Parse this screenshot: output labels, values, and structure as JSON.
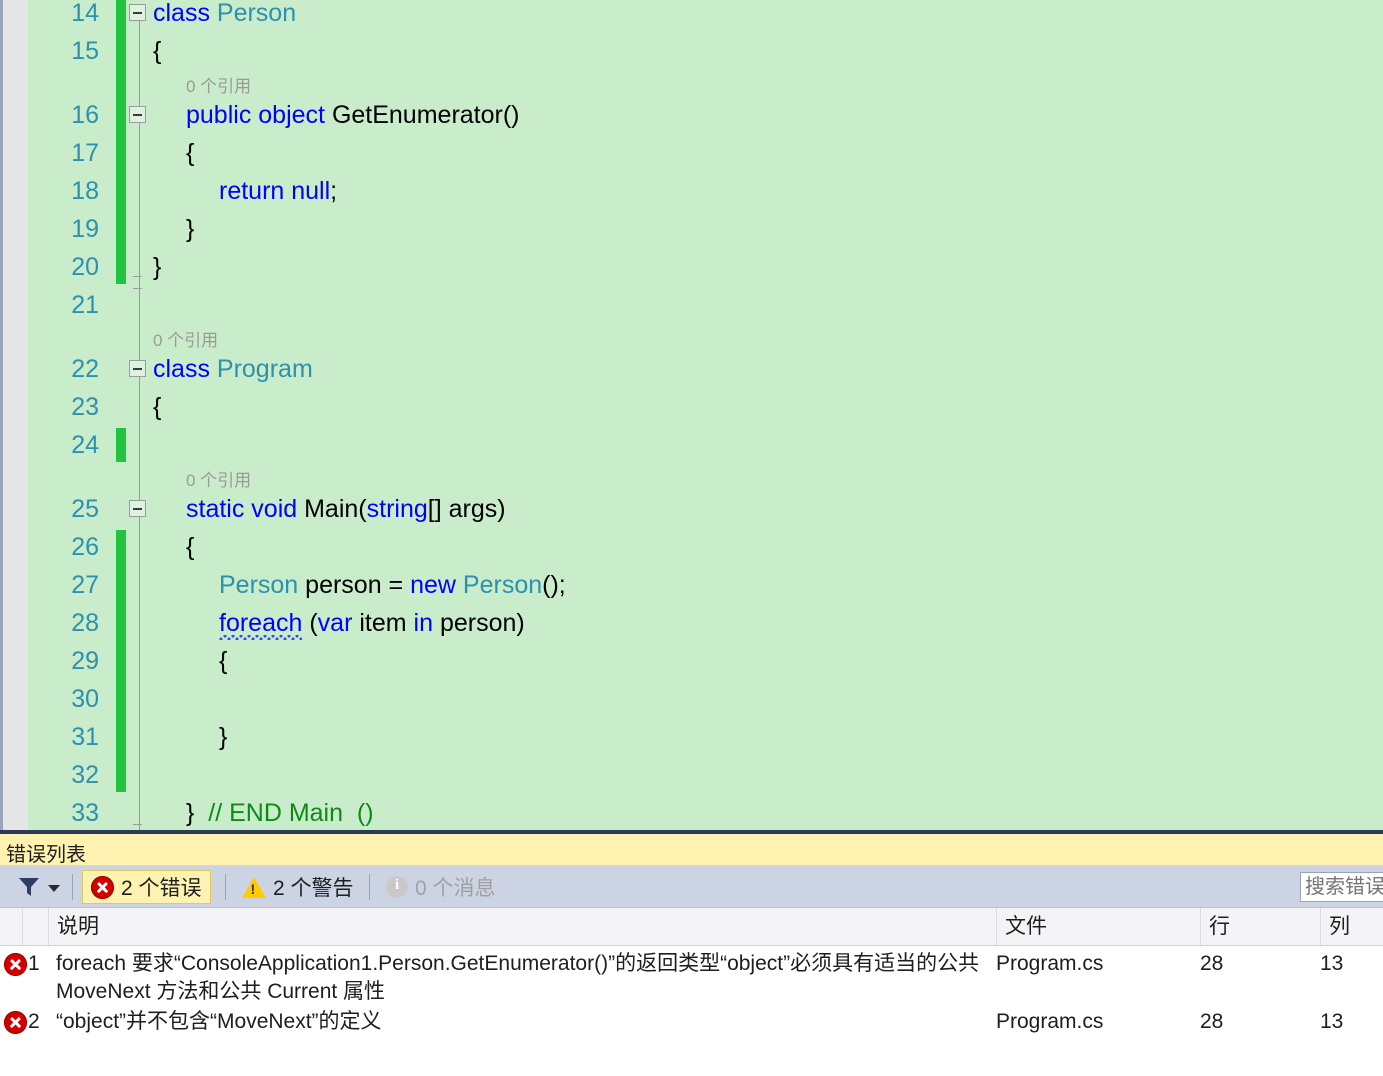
{
  "editor": {
    "background_color": "#c9ecca",
    "line_number_color": "#2b91af",
    "change_bar_color": "#22c33f",
    "reference_lens_text": "0 个引用",
    "lines": [
      {
        "num": "14",
        "indent": 0,
        "segments": [
          {
            "t": "class ",
            "c": "kw"
          },
          {
            "t": "Person",
            "c": "type"
          }
        ]
      },
      {
        "num": "15",
        "indent": 0,
        "segments": [
          {
            "t": "{",
            "c": "plain"
          }
        ]
      },
      {
        "num": "16",
        "indent": 1,
        "segments": [
          {
            "t": "public object ",
            "c": "kw"
          },
          {
            "t": "GetEnumerator()",
            "c": "plain"
          }
        ]
      },
      {
        "num": "17",
        "indent": 1,
        "segments": [
          {
            "t": "{",
            "c": "plain"
          }
        ]
      },
      {
        "num": "18",
        "indent": 2,
        "segments": [
          {
            "t": "return null",
            "c": "kw"
          },
          {
            "t": ";",
            "c": "plain"
          }
        ]
      },
      {
        "num": "19",
        "indent": 1,
        "segments": [
          {
            "t": "}",
            "c": "plain"
          }
        ]
      },
      {
        "num": "20",
        "indent": 0,
        "segments": [
          {
            "t": "}",
            "c": "plain"
          }
        ]
      },
      {
        "num": "21",
        "indent": 0,
        "segments": []
      },
      {
        "num": "22",
        "indent": 0,
        "segments": [
          {
            "t": "class ",
            "c": "kw"
          },
          {
            "t": "Program",
            "c": "type"
          }
        ]
      },
      {
        "num": "23",
        "indent": 0,
        "segments": [
          {
            "t": "{",
            "c": "plain"
          }
        ]
      },
      {
        "num": "24",
        "indent": 0,
        "segments": []
      },
      {
        "num": "25",
        "indent": 1,
        "segments": [
          {
            "t": "static void ",
            "c": "kw"
          },
          {
            "t": "Main(",
            "c": "plain"
          },
          {
            "t": "string",
            "c": "kw"
          },
          {
            "t": "[] args)",
            "c": "plain"
          }
        ]
      },
      {
        "num": "26",
        "indent": 1,
        "segments": [
          {
            "t": "{",
            "c": "plain"
          }
        ]
      },
      {
        "num": "27",
        "indent": 2,
        "segments": [
          {
            "t": "Person",
            "c": "type"
          },
          {
            "t": " person = ",
            "c": "plain"
          },
          {
            "t": "new ",
            "c": "kw"
          },
          {
            "t": "Person",
            "c": "type"
          },
          {
            "t": "();",
            "c": "plain"
          }
        ]
      },
      {
        "num": "28",
        "indent": 2,
        "segments": [
          {
            "t": "foreach",
            "c": "squiggle"
          },
          {
            "t": " (",
            "c": "plain"
          },
          {
            "t": "var",
            "c": "kw"
          },
          {
            "t": " item ",
            "c": "plain"
          },
          {
            "t": "in",
            "c": "kw"
          },
          {
            "t": " person)",
            "c": "plain"
          }
        ]
      },
      {
        "num": "29",
        "indent": 2,
        "segments": [
          {
            "t": "{",
            "c": "plain"
          }
        ]
      },
      {
        "num": "30",
        "indent": 2,
        "segments": []
      },
      {
        "num": "31",
        "indent": 2,
        "segments": [
          {
            "t": "}",
            "c": "plain"
          }
        ]
      },
      {
        "num": "32",
        "indent": 2,
        "segments": []
      },
      {
        "num": "33",
        "indent": 1,
        "segments": [
          {
            "t": "}  ",
            "c": "plain"
          },
          {
            "t": "// END Main  ()",
            "c": "cmt"
          }
        ]
      }
    ],
    "reference_lens_lines": [
      "16",
      "22",
      "25"
    ],
    "collapse_boxes": [
      "14",
      "16",
      "22",
      "25"
    ],
    "change_bar_ranges": [
      [
        "14",
        "20"
      ],
      [
        "24",
        "24"
      ],
      [
        "26",
        "32"
      ]
    ]
  },
  "error_list": {
    "title": "错误列表",
    "toolbar": {
      "filter_icon": "filter-icon",
      "errors_label": "2 个错误",
      "warnings_label": "2 个警告",
      "messages_label": "0 个消息",
      "errors_active": true,
      "search_placeholder": "搜索错误列表"
    },
    "columns": [
      {
        "key": "desc",
        "label": "说明"
      },
      {
        "key": "file",
        "label": "文件"
      },
      {
        "key": "line",
        "label": "行"
      },
      {
        "key": "col",
        "label": "列"
      }
    ],
    "rows": [
      {
        "severity": "error",
        "index": "1",
        "description": "foreach 要求“ConsoleApplication1.Person.GetEnumerator()”的返回类型“object”必须具有适当的公共 MoveNext 方法和公共 Current 属性",
        "file": "Program.cs",
        "line": "28",
        "column": "13"
      },
      {
        "severity": "error",
        "index": "2",
        "description": "“object”并不包含“MoveNext”的定义",
        "file": "Program.cs",
        "line": "28",
        "column": "13"
      }
    ]
  }
}
